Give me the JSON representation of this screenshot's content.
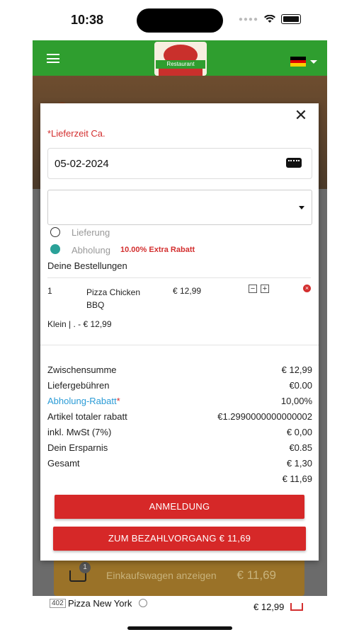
{
  "status_bar": {
    "time": "10:38"
  },
  "header": {
    "logo_text": "Restaurant DHILLON",
    "flag_colors": [
      "#000000",
      "#dd0000",
      "#ffce00"
    ]
  },
  "background": {
    "cart_badge": "1",
    "cart_label": "Einkaufswagen anzeigen",
    "cart_total": "€ 11,69",
    "row_number": "402",
    "row_name": "Pizza New York",
    "row_price": "€ 12,99"
  },
  "modal": {
    "delivery_time_label": "*Lieferzeit Ca.",
    "date_value": "05-02-2024",
    "select_value": "",
    "options": [
      {
        "label": "Lieferung",
        "selected": false
      },
      {
        "label": "Abholung",
        "selected": true,
        "note": "10.00% Extra Rabatt"
      }
    ],
    "orders_title": "Deine Bestellungen",
    "item": {
      "qty": "1",
      "name": "Pizza Chicken BBQ",
      "price": "€ 12,99",
      "minus": "−",
      "plus": "+",
      "remove": "×",
      "variant": "Klein | . - € 12,99"
    },
    "summary": [
      {
        "label": "Zwischensumme",
        "value": "€ 12,99"
      },
      {
        "label": "Liefergebühren",
        "value": "€0.00"
      },
      {
        "label": "Abholung-Rabatt",
        "star": "*",
        "value": "10,00%"
      },
      {
        "label": "Artikel totaler rabatt",
        "value": "€1.2990000000000002"
      },
      {
        "label": "inkl. MwSt (7%)",
        "value": "€ 0,00"
      },
      {
        "label": "Dein Ersparnis",
        "value": "€0.85"
      },
      {
        "label": "Gesamt",
        "value": "€ 1,30"
      },
      {
        "label": "",
        "value": "€ 11,69"
      }
    ],
    "login_button": "ANMELDUNG",
    "checkout_button": "ZUM BEZAHLVORGANG € 11,69",
    "close": "✕"
  }
}
